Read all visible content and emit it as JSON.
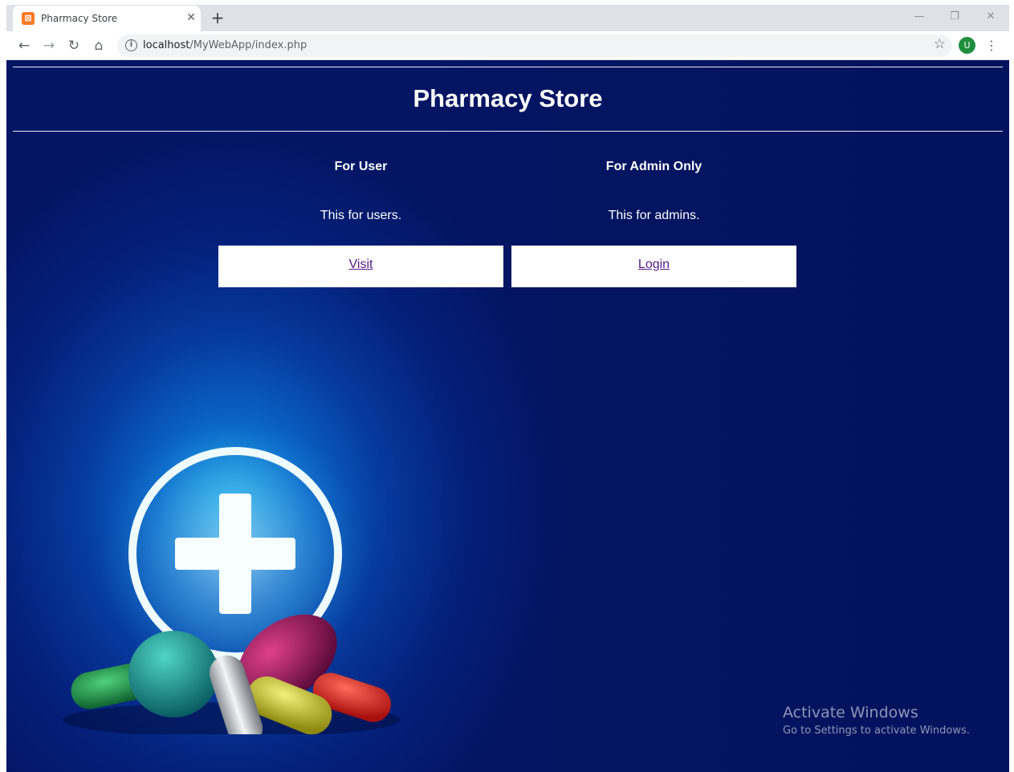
{
  "browser": {
    "tab_title": "Pharmacy Store",
    "favicon_glyph": "⊠",
    "close_glyph": "✕",
    "new_tab_glyph": "+",
    "url_host": "localhost",
    "url_path": "/MyWebApp/index.php",
    "profile_initial": "U",
    "back_glyph": "←",
    "forward_glyph": "→",
    "reload_glyph": "↻",
    "home_glyph": "⌂",
    "info_glyph": "i",
    "star_glyph": "☆",
    "menu_glyph": "⋮",
    "minimize_glyph": "—",
    "restore_glyph": "❐",
    "window_close_glyph": "✕"
  },
  "page": {
    "title": "Pharmacy Store",
    "user_column": {
      "heading": "For User",
      "description": "This for users.",
      "button_label": "Visit"
    },
    "admin_column": {
      "heading": "For Admin Only",
      "description": "This for admins.",
      "button_label": "Login"
    }
  },
  "watermark": {
    "line1": "Activate Windows",
    "line2": "Go to Settings to activate Windows."
  },
  "colors": {
    "page_background": "#031563",
    "glow": "#1fa8e6",
    "link": "#551a8b",
    "avatar": "#1e8e3e",
    "favicon": "#fb7a24"
  },
  "icons": [
    "pharmacy-cross-icon",
    "pills-illustration"
  ]
}
